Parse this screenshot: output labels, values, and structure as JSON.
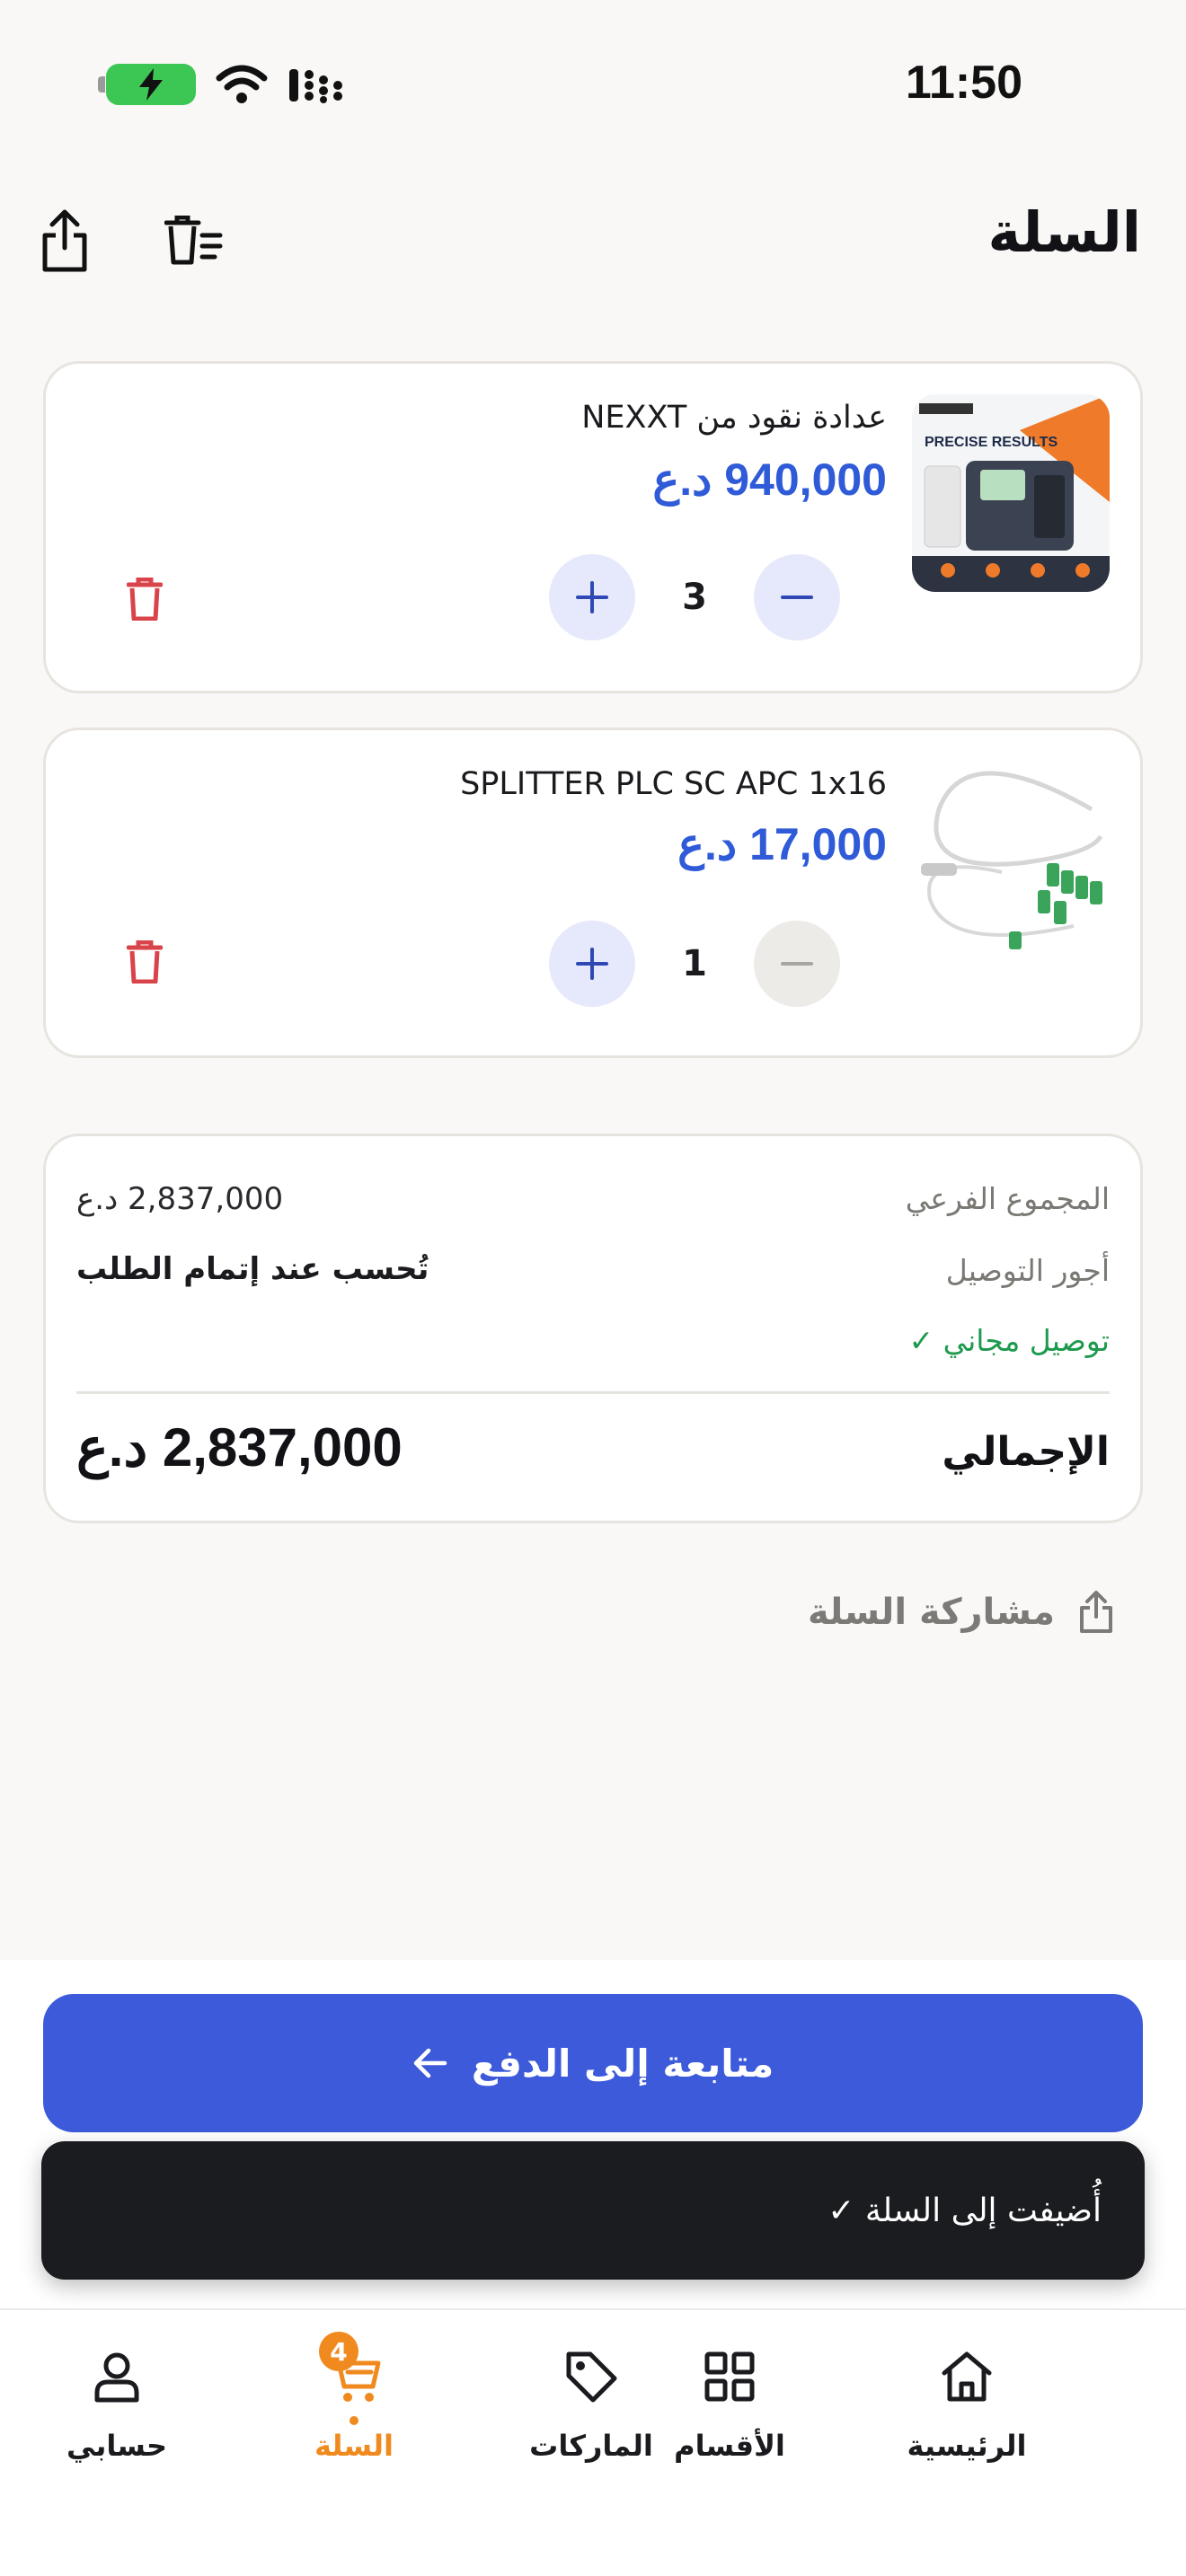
{
  "status_bar": {
    "time": "11:50"
  },
  "header": {
    "title": "السلة"
  },
  "cart_items": [
    {
      "title": "عدادة نقود من NEXXT",
      "price": "940,000 د.ع",
      "quantity": "3",
      "image_text": "PRECISE RESULTS"
    },
    {
      "title": "SPLITTER PLC SC APC 1x16",
      "price": "17,000 د.ع",
      "quantity": "1"
    }
  ],
  "summary": {
    "subtotal_label": "المجموع الفرعي",
    "subtotal_value": "2,837,000 د.ع",
    "delivery_label": "أجور التوصيل",
    "delivery_value": "تُحسب عند إتمام الطلب",
    "free_delivery": "توصيل مجاني ✓",
    "total_label": "الإجمالي",
    "total_value": "2,837,000 د.ع"
  },
  "share": {
    "label": "مشاركة السلة"
  },
  "checkout": {
    "label": "متابعة إلى الدفع"
  },
  "toast": {
    "message": "أُضيفت إلى السلة ✓"
  },
  "tabbar": {
    "items": [
      {
        "label": "الرئيسية",
        "icon": "home-icon"
      },
      {
        "label": "الأقسام",
        "icon": "grid-icon"
      },
      {
        "label": "الماركات",
        "icon": "tag-icon"
      },
      {
        "label": "السلة",
        "icon": "cart-icon",
        "badge": "4",
        "active": true
      },
      {
        "label": "حسابي",
        "icon": "user-icon"
      }
    ]
  },
  "colors": {
    "accent": "#3c5ad9",
    "price": "#2f5ad8",
    "active_tab": "#f08a1f",
    "delete": "#d9434a",
    "success": "#1d9a4d"
  }
}
